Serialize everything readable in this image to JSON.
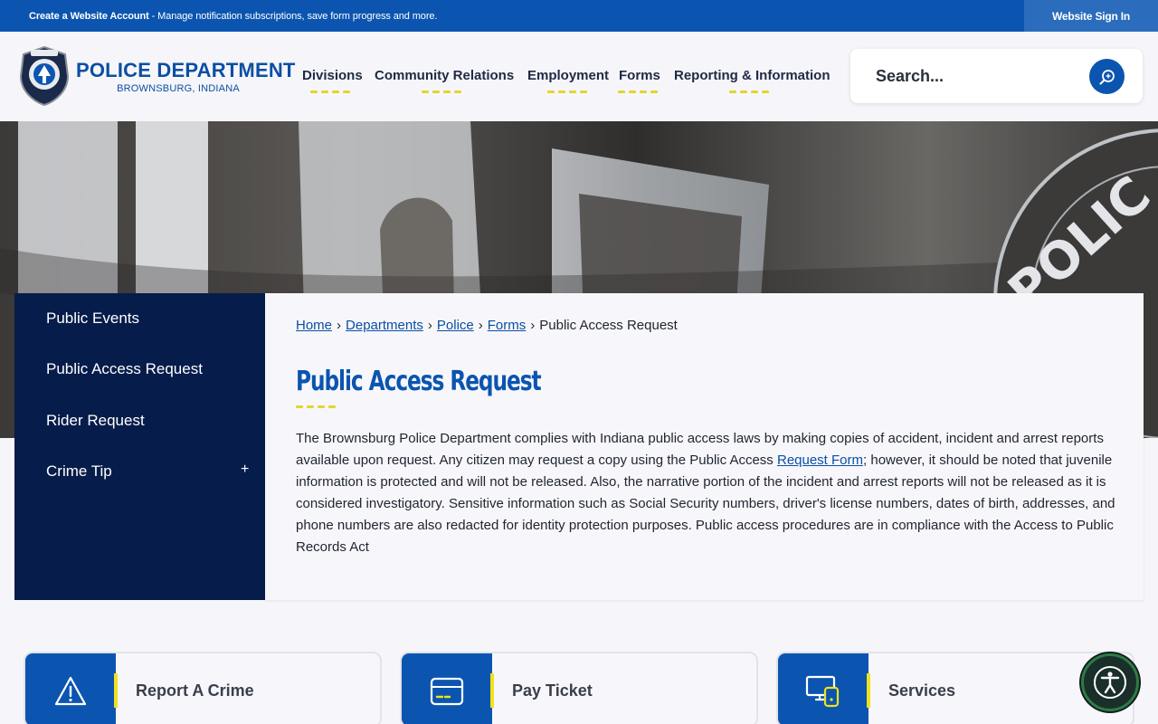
{
  "topbar": {
    "create_account": "Create a Website Account",
    "message": " - Manage notification subscriptions, save form progress and more.",
    "signin": "Website Sign In"
  },
  "brand": {
    "name": "POLICE DEPARTMENT",
    "location": "BROWNSBURG, INDIANA"
  },
  "nav": [
    "Divisions",
    "Community Relations",
    "Employment",
    "Forms",
    "Reporting & Information"
  ],
  "search": {
    "placeholder": "Search..."
  },
  "sidenav": {
    "items": [
      "Public Events",
      "Public Access Request",
      "Rider Request",
      "Crime Tip"
    ],
    "expand_symbol": "+"
  },
  "breadcrumb": {
    "links": [
      "Home",
      "Departments",
      "Police",
      "Forms"
    ],
    "current": "Public Access Request",
    "separator": "›"
  },
  "page": {
    "title": "Public Access Request",
    "body_before_link": "The Brownsburg Police Department complies with Indiana public access laws by making copies of accident, incident and arrest reports available upon request. Any citizen may request a copy using the Public Access ",
    "link_text": "Request Form",
    "body_after_link": "; however, it should be noted that juvenile information is protected and will not be released. Also, the narrative portion of the incident and arrest reports will not be released as it is considered investigatory. Sensitive information such as Social Security numbers, driver's license numbers, dates of birth, addresses, and phone numbers are also redacted for identity protection purposes. Public access procedures are in compliance with the Access to Public Records Act"
  },
  "tiles": [
    {
      "label": "Report A Crime",
      "icon": "warning-icon"
    },
    {
      "label": "Pay Ticket",
      "icon": "card-icon"
    },
    {
      "label": "Services",
      "icon": "devices-icon"
    }
  ],
  "colors": {
    "primary": "#0b55b0",
    "navy": "#061c4a",
    "accent_yellow": "#e3d62a"
  }
}
